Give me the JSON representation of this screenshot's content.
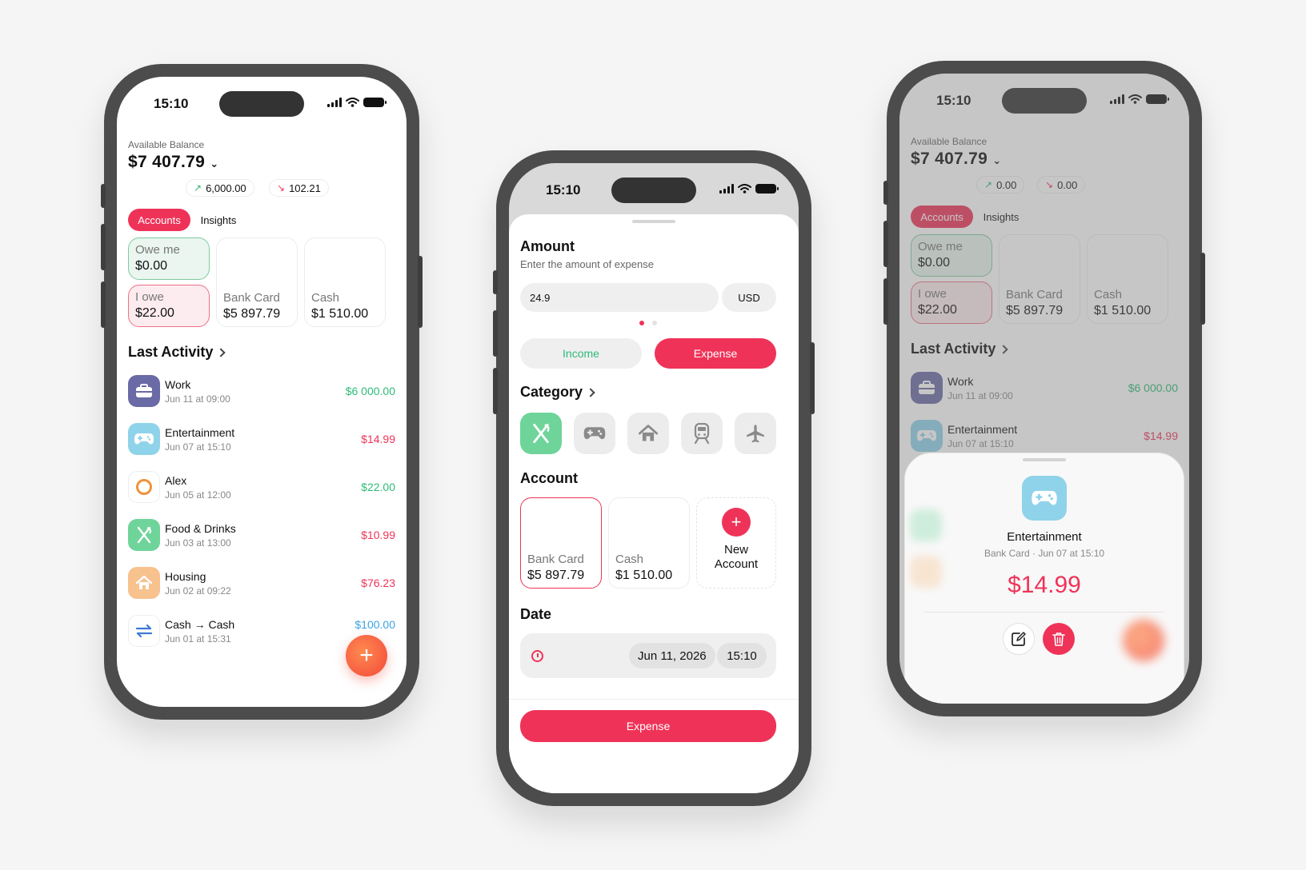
{
  "status": {
    "time": "15:10"
  },
  "phone1": {
    "balance_label": "Available Balance",
    "balance": "$7 407.79",
    "income_chip": "6,000.00",
    "expense_chip": "102.21",
    "tabs": [
      "Accounts",
      "Insights"
    ],
    "owe_me": {
      "name": "Owe me",
      "value": "$0.00"
    },
    "i_owe": {
      "name": "I owe",
      "value": "$22.00"
    },
    "bank": {
      "name": "Bank Card",
      "value": "$5 897.79"
    },
    "cash": {
      "name": "Cash",
      "value": "$1 510.00"
    },
    "last_activity": "Last Activity",
    "activities": [
      {
        "title": "Work",
        "date": "Jun 11 at 09:00",
        "amount": "$6 000.00"
      },
      {
        "title": "Entertainment",
        "date": "Jun 07 at 15:10",
        "amount": "$14.99"
      },
      {
        "title": "Alex",
        "date": "Jun 05 at 12:00",
        "amount": "$22.00"
      },
      {
        "title": "Food & Drinks",
        "date": "Jun 03 at 13:00",
        "amount": "$10.99"
      },
      {
        "title": "Housing",
        "date": "Jun 02 at 09:22",
        "amount": "$76.23"
      },
      {
        "title": "Cash → Cash",
        "date": "Jun 01 at 15:31",
        "amount": "$100.00"
      }
    ],
    "fab_label": "+"
  },
  "phone2": {
    "amount_title": "Amount",
    "amount_sub": "Enter the amount of expense",
    "amount_value": "24.9",
    "currency": "USD",
    "income_label": "Income",
    "expense_label": "Expense",
    "category_title": "Category",
    "account_title": "Account",
    "bank": {
      "name": "Bank Card",
      "value": "$5 897.79"
    },
    "cash": {
      "name": "Cash",
      "value": "$1 510.00"
    },
    "new_account": "New Account",
    "date_title": "Date",
    "date_value": "Jun 11, 2026",
    "time_value": "15:10",
    "submit_label": "Expense"
  },
  "phone3": {
    "balance_label": "Available Balance",
    "balance": "$7 407.79",
    "income_chip": "0.00",
    "expense_chip": "0.00",
    "tabs": [
      "Accounts",
      "Insights"
    ],
    "owe_me": {
      "name": "Owe me",
      "value": "$0.00"
    },
    "i_owe": {
      "name": "I owe",
      "value": "$22.00"
    },
    "bank": {
      "name": "Bank Card",
      "value": "$5 897.79"
    },
    "cash": {
      "name": "Cash",
      "value": "$1 510.00"
    },
    "last_activity": "Last Activity",
    "activities": [
      {
        "title": "Work",
        "date": "Jun 11 at 09:00",
        "amount": "$6 000.00"
      },
      {
        "title": "Entertainment",
        "date": "Jun 07 at 15:10",
        "amount": "$14.99"
      }
    ],
    "detail": {
      "title": "Entertainment",
      "meta": "Bank Card · Jun 07 at 15:10",
      "amount": "$14.99"
    }
  },
  "colors": {
    "accent": "#ef3358",
    "green": "#2dbb78",
    "blue": "#3aa3e0",
    "work": "#6a6aa6",
    "food": "#6fd49a",
    "housing": "#f7c28e",
    "gamepad": "#8fd3ea"
  }
}
